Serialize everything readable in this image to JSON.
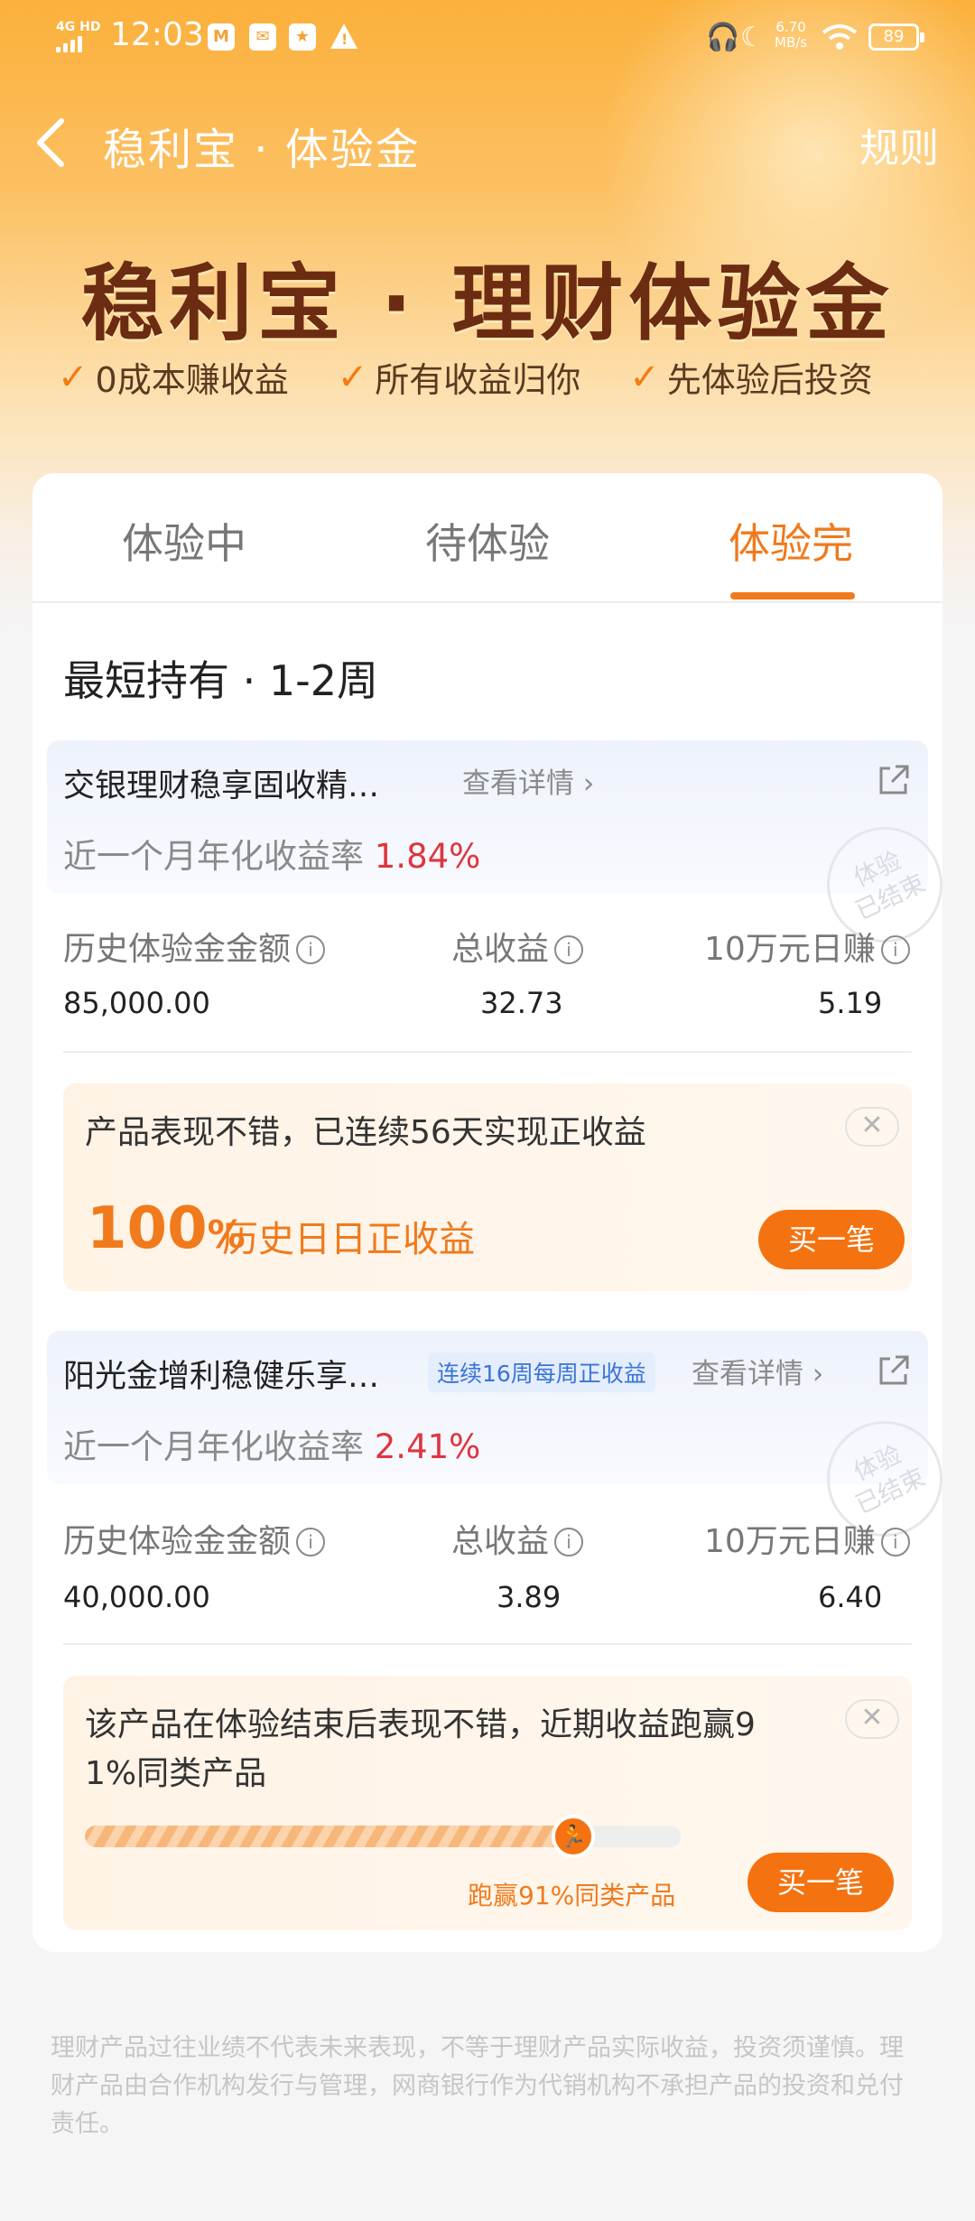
{
  "status_bar": {
    "network": "4G HD",
    "time": "12:03",
    "speed": "6.70",
    "speed_unit": "MB/s",
    "battery": "89"
  },
  "nav": {
    "title": "稳利宝 · 体验金",
    "rules": "规则"
  },
  "hero": {
    "title": "稳利宝 · 理财体验金",
    "features": [
      "0成本赚收益",
      "所有收益归你",
      "先体验后投资"
    ]
  },
  "tabs": [
    {
      "label": "体验中",
      "active": false
    },
    {
      "label": "待体验",
      "active": false
    },
    {
      "label": "体验完",
      "active": true
    }
  ],
  "section_title": "最短持有 · 1-2周",
  "stamp_text": [
    "体验",
    "已结束"
  ],
  "products": [
    {
      "name": "交银理财稳享固收精…",
      "tag": "",
      "detail": "查看详情",
      "rate_label": "近一个月年化收益率",
      "rate": "1.84%",
      "stats": [
        {
          "label": "历史体验金金额",
          "value": "85,000.00"
        },
        {
          "label": "总收益",
          "value": "32.73"
        },
        {
          "label": "10万元日赚",
          "value": "5.19"
        }
      ],
      "promo": {
        "message": "产品表现不错，已连续56天实现正收益",
        "big_value": "100",
        "big_unit": "%",
        "big_text": "历史日日正收益",
        "button": "买一笔"
      }
    },
    {
      "name": "阳光金增利稳健乐享…",
      "tag": "连续16周每周正收益",
      "detail": "查看详情",
      "rate_label": "近一个月年化收益率",
      "rate": "2.41%",
      "stats": [
        {
          "label": "历史体验金金额",
          "value": "40,000.00"
        },
        {
          "label": "总收益",
          "value": "3.89"
        },
        {
          "label": "10万元日赚",
          "value": "6.40"
        }
      ],
      "promo": {
        "message": "该产品在体验结束后表现不错，近期收益跑赢9 1%同类产品",
        "progress": 0.91,
        "progress_label": "跑赢91%同类产品",
        "button": "买一笔"
      }
    }
  ],
  "disclaimer": "理财产品过往业绩不代表未来表现，不等于理财产品实际收益，投资须谨慎。理财产品由合作机构发行与管理，网商银行作为代销机构不承担产品的投资和兑付责任。",
  "colors": {
    "accent": "#f07a1c",
    "rate_red": "#e0353d",
    "hero_title": "#6b2c12"
  }
}
